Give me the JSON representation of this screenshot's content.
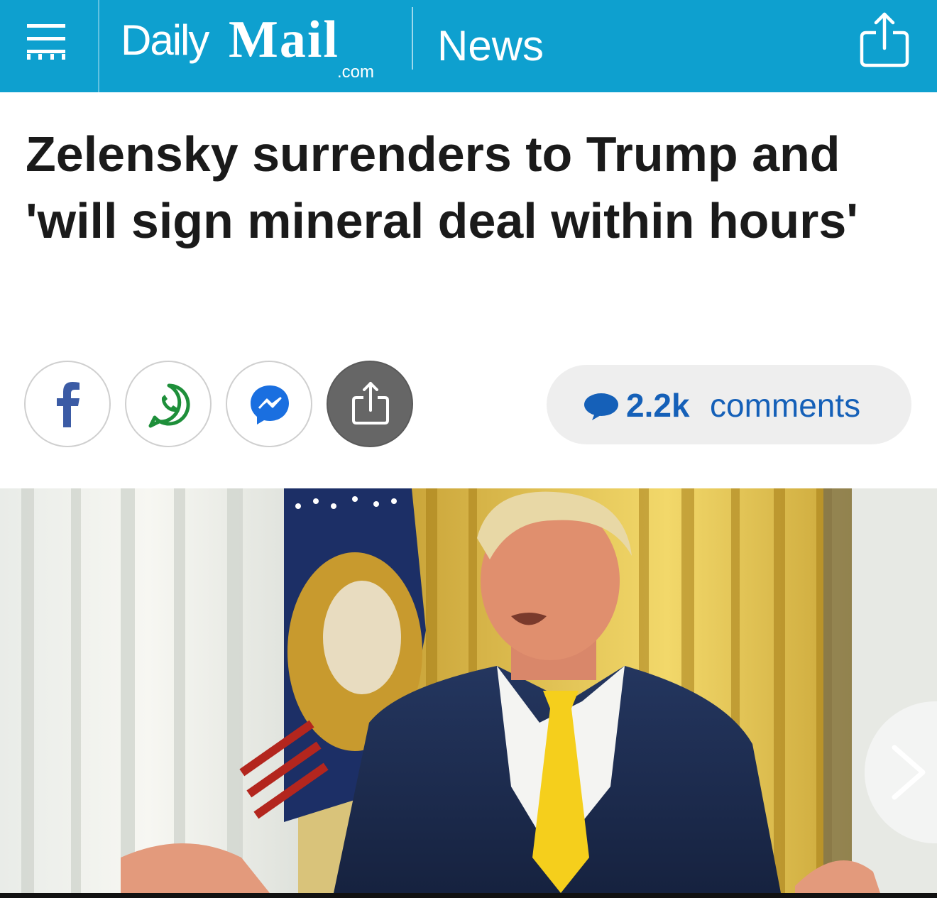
{
  "header": {
    "logo": {
      "word1": "Daily",
      "word2": "Mail",
      "domain": ".com"
    },
    "section": "News",
    "icons": {
      "menu": "hamburger-menu-icon",
      "share": "share-icon"
    },
    "color": "#0ea0cf"
  },
  "article": {
    "headline": "Zelensky surrenders to Trump and 'will sign mineral deal within hours'"
  },
  "share_bar": {
    "buttons": [
      {
        "icon": "facebook-icon"
      },
      {
        "icon": "whatsapp-icon"
      },
      {
        "icon": "messenger-icon"
      },
      {
        "icon": "share-icon"
      }
    ],
    "comments": {
      "count": "2.2k",
      "label": "comments",
      "icon": "speech-bubble-icon",
      "color": "#1560b8"
    }
  },
  "media": {
    "next_icon": "chevron-right-icon"
  }
}
